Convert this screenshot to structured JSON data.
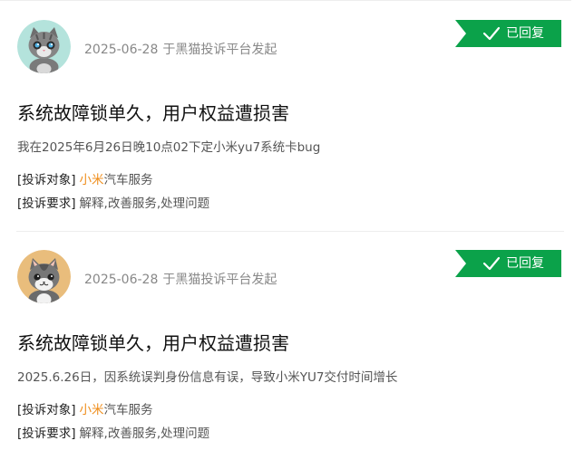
{
  "badge_color": "#0ba24a",
  "brand_color": "#ef8e1c",
  "complaints": [
    {
      "avatar": "gray-cat-avatar",
      "date": "2025-06-28",
      "meta_suffix": "于黑猫投诉平台发起",
      "status": "已回复",
      "title": "系统故障锁单久，用户权益遭损害",
      "description": "我在2025年6月26日晚10点02下定小米yu7系统卡bug",
      "target_label": "[投诉对象]",
      "target_brand": "小米",
      "target_rest": "汽车服务",
      "request_label": "[投诉要求]",
      "request_value": "解释,改善服务,处理问题"
    },
    {
      "avatar": "gray-cat-avatar-orange-bg",
      "date": "2025-06-28",
      "meta_suffix": "于黑猫投诉平台发起",
      "status": "已回复",
      "title": "系统故障锁单久，用户权益遭损害",
      "description": "2025.6.26日，因系统误判身份信息有误，导致小米YU7交付时间增长",
      "target_label": "[投诉对象]",
      "target_brand": "小米",
      "target_rest": "汽车服务",
      "request_label": "[投诉要求]",
      "request_value": "解释,改善服务,处理问题"
    }
  ]
}
